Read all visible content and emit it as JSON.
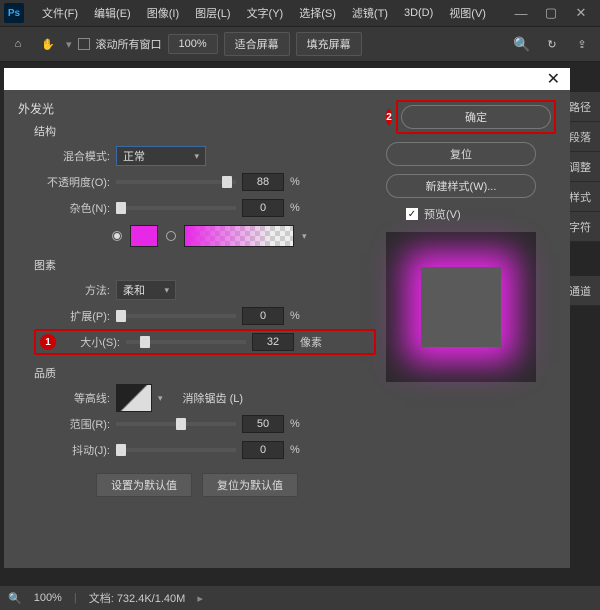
{
  "menubar": {
    "logo": "Ps",
    "items": [
      "文件(F)",
      "编辑(E)",
      "图像(I)",
      "图层(L)",
      "文字(Y)",
      "选择(S)",
      "滤镜(T)",
      "3D(D)",
      "视图(V)"
    ]
  },
  "optbar": {
    "scroll_all": "滚动所有窗口",
    "zoom": "100%",
    "fit": "适合屏幕",
    "fill": "填充屏幕"
  },
  "right_tabs": [
    "路径",
    "段落",
    "调整",
    "样式",
    "字符",
    "通道"
  ],
  "dialog": {
    "effect_title": "外发光",
    "group_structure": "结构",
    "blend_label": "混合模式:",
    "blend_value": "正常",
    "opacity_label": "不透明度(O):",
    "opacity_value": "88",
    "percent": "%",
    "noise_label": "杂色(N):",
    "noise_value": "0",
    "group_elements": "图素",
    "method_label": "方法:",
    "method_value": "柔和",
    "spread_label": "扩展(P):",
    "spread_value": "0",
    "size_label": "大小(S):",
    "size_value": "32",
    "size_unit": "像素",
    "group_quality": "品质",
    "contour_label": "等高线:",
    "antialias": "消除锯齿 (L)",
    "range_label": "范围(R):",
    "range_value": "50",
    "jitter_label": "抖动(J):",
    "jitter_value": "0",
    "make_default": "设置为默认值",
    "reset_default": "复位为默认值",
    "ok": "确定",
    "cancel": "复位",
    "new_style": "新建样式(W)...",
    "preview": "预览(V)",
    "badge1": "1",
    "badge2": "2"
  },
  "status": {
    "zoom": "100%",
    "docinfo": "文档: 732.4K/1.40M"
  }
}
